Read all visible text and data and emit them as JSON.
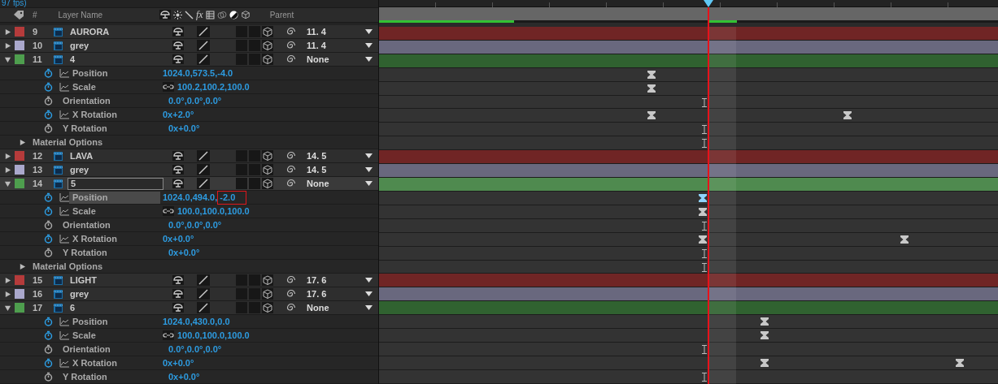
{
  "header": {
    "fps_text": "97 fps)",
    "number_label": "#",
    "name_label": "Layer Name",
    "fx_label": "fx",
    "parent_label": "Parent"
  },
  "rows": [
    {
      "kind": "layer",
      "number": "9",
      "name": "AURORA",
      "color": "#b53b3b",
      "expanded": false,
      "selected": false,
      "parent": "11. 4"
    },
    {
      "kind": "layer",
      "number": "10",
      "name": "grey",
      "color": "#aaa8cc",
      "expanded": false,
      "selected": false,
      "parent": "11. 4"
    },
    {
      "kind": "layer",
      "number": "11",
      "name": "4",
      "color": "#4e9e4e",
      "expanded": true,
      "selected": false,
      "parent": "None"
    },
    {
      "kind": "property",
      "name": "Position",
      "value": "1024.0,573.5,-4.0",
      "animated": true,
      "linked": false,
      "highlighted": false
    },
    {
      "kind": "property",
      "name": "Scale",
      "value": "100.2,100.2,100.0",
      "animated": true,
      "linked": true,
      "highlighted": false
    },
    {
      "kind": "property",
      "name": "Orientation",
      "value": "0.0°,0.0°,0.0°",
      "animated": false,
      "linked": false,
      "highlighted": false
    },
    {
      "kind": "property",
      "name": "X Rotation",
      "value": "0x+2.0°",
      "animated": true,
      "linked": false,
      "highlighted": false
    },
    {
      "kind": "property",
      "name": "Y Rotation",
      "value": "0x+0.0°",
      "animated": false,
      "linked": false,
      "highlighted": false
    },
    {
      "kind": "group",
      "name": "Material Options",
      "expanded": false
    },
    {
      "kind": "layer",
      "number": "12",
      "name": "LAVA",
      "color": "#b53b3b",
      "expanded": false,
      "selected": false,
      "parent": "14. 5"
    },
    {
      "kind": "layer",
      "number": "13",
      "name": "grey",
      "color": "#aaa8cc",
      "expanded": false,
      "selected": false,
      "parent": "14. 5"
    },
    {
      "kind": "layer",
      "number": "14",
      "name": "5",
      "color": "#4e9e4e",
      "expanded": true,
      "selected": true,
      "parent": "None"
    },
    {
      "kind": "property",
      "name": "Position",
      "value": "1024.0,494.0,",
      "boxed_value": "-2.0",
      "animated": true,
      "linked": false,
      "highlighted": true
    },
    {
      "kind": "property",
      "name": "Scale",
      "value": "100.0,100.0,100.0",
      "animated": true,
      "linked": true,
      "highlighted": false
    },
    {
      "kind": "property",
      "name": "Orientation",
      "value": "0.0°,0.0°,0.0°",
      "animated": false,
      "linked": false,
      "highlighted": false
    },
    {
      "kind": "property",
      "name": "X Rotation",
      "value": "0x+0.0°",
      "animated": true,
      "linked": false,
      "highlighted": false
    },
    {
      "kind": "property",
      "name": "Y Rotation",
      "value": "0x+0.0°",
      "animated": false,
      "linked": false,
      "highlighted": false
    },
    {
      "kind": "group",
      "name": "Material Options",
      "expanded": false
    },
    {
      "kind": "layer",
      "number": "15",
      "name": "LIGHT",
      "color": "#b53b3b",
      "expanded": false,
      "selected": false,
      "parent": "17. 6"
    },
    {
      "kind": "layer",
      "number": "16",
      "name": "grey",
      "color": "#aaa8cc",
      "expanded": false,
      "selected": false,
      "parent": "17. 6"
    },
    {
      "kind": "layer",
      "number": "17",
      "name": "6",
      "color": "#4e9e4e",
      "expanded": true,
      "selected": false,
      "parent": "None"
    },
    {
      "kind": "property",
      "name": "Position",
      "value": "1024.0,430.0,0.0",
      "animated": true,
      "linked": false,
      "highlighted": false
    },
    {
      "kind": "property",
      "name": "Scale",
      "value": "100.0,100.0,100.0",
      "animated": true,
      "linked": true,
      "highlighted": false
    },
    {
      "kind": "property",
      "name": "Orientation",
      "value": "0.0°,0.0°,0.0°",
      "animated": false,
      "linked": false,
      "highlighted": false
    },
    {
      "kind": "property",
      "name": "X Rotation",
      "value": "0x+0.0°",
      "animated": true,
      "linked": false,
      "highlighted": false
    },
    {
      "kind": "property",
      "name": "Y Rotation",
      "value": "0x+0.0°",
      "animated": false,
      "linked": false,
      "highlighted": false
    }
  ]
}
